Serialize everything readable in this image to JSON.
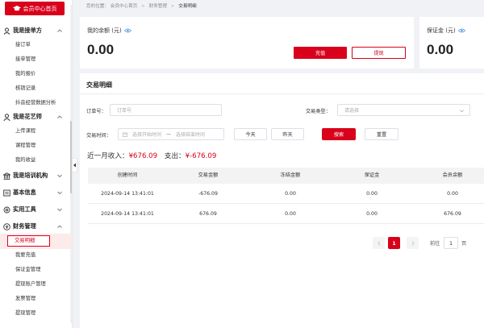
{
  "sidebar": {
    "home_button": "会员中心首页",
    "groups": [
      {
        "label": "我是接单方",
        "items": [
          "接订单",
          "接单管理",
          "我的报价",
          "核销记录",
          "抖音经营数据分析"
        ]
      },
      {
        "label": "我是花艺师",
        "items": [
          "上传课程",
          "课程管理",
          "我的收益"
        ]
      },
      {
        "label": "我是培训机构"
      },
      {
        "label": "基本信息"
      },
      {
        "label": "实用工具"
      },
      {
        "label": "财务管理",
        "items": [
          "交易明细",
          "我要充值",
          "保证金管理",
          "提现账户管理",
          "发票管理",
          "提现管理"
        ]
      }
    ]
  },
  "breadcrumb": {
    "prefix": "您的位置：",
    "items": [
      "会员中心首页",
      "财务管理",
      "交易明细"
    ]
  },
  "balance": {
    "title": "我的余额 (元)",
    "amount": "0.00",
    "recharge_label": "充值",
    "withdraw_label": "提现"
  },
  "deposit": {
    "title": "保证金 (元)",
    "amount": "0.00"
  },
  "transactions": {
    "title": "交易明细",
    "filters": {
      "order_label": "订单号：",
      "order_placeholder": "订单号",
      "type_label": "交易类型：",
      "type_placeholder": "请选择",
      "time_label": "交易时间：",
      "start_placeholder": "选择开始时间",
      "range_sep": "—",
      "end_placeholder": "选择结束时间",
      "today_label": "今天",
      "yesterday_label": "昨天",
      "search_label": "搜索",
      "reset_label": "重置"
    },
    "summary": {
      "income_label": "近一月收入：",
      "income_value": "¥676.09",
      "expense_label": "支出：",
      "expense_value": "¥-676.09"
    },
    "columns": [
      "创建时间",
      "交易金额",
      "冻结金额",
      "保证金",
      "会员余额"
    ],
    "rows": [
      [
        "2024-09-14 13:41:01",
        "-676.09",
        "0.00",
        "0.00",
        "0.00"
      ],
      [
        "2024-09-14 13:41:01",
        "676.09",
        "0.00",
        "0.00",
        "676.09"
      ]
    ],
    "pagination": {
      "current_page": "1",
      "goto_label": "前往",
      "goto_value": "1",
      "page_suffix": "页"
    }
  },
  "colors": {
    "brand_red": "#d9001b",
    "page_bg": "#f0f2f5",
    "header_bg": "#f3f3f3"
  },
  "icons": [
    "graduation-cap-icon",
    "user-icon",
    "chevron-up-icon",
    "chevron-down-icon",
    "person-icon",
    "institution-icon",
    "info-card-icon",
    "tool-icon",
    "finance-icon",
    "eye-icon",
    "calendar-icon",
    "chevron-left-icon",
    "chevron-right-icon"
  ]
}
